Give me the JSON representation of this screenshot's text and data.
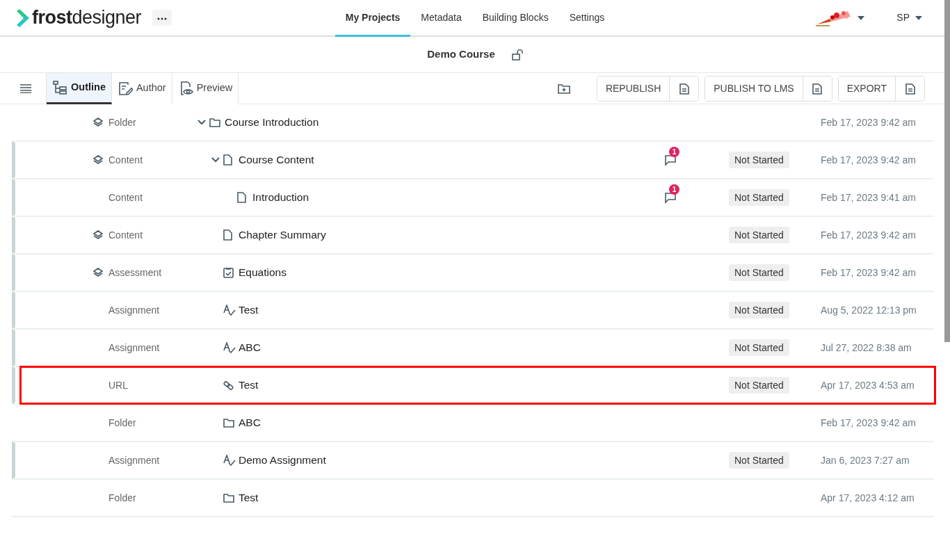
{
  "app": {
    "logo_bold": "frost",
    "logo_light": "designer"
  },
  "nav_tabs": [
    {
      "label": "My Projects",
      "selected": true
    },
    {
      "label": "Metadata",
      "selected": false
    },
    {
      "label": "Building Blocks",
      "selected": false
    },
    {
      "label": "Settings",
      "selected": false
    }
  ],
  "user": {
    "initials": "SP"
  },
  "course": {
    "title": "Demo Course",
    "locked": false
  },
  "view_tabs": [
    {
      "label": "Outline",
      "kind": "outline",
      "selected": true
    },
    {
      "label": "Author",
      "kind": "author",
      "selected": false
    },
    {
      "label": "Preview",
      "kind": "preview",
      "selected": false
    }
  ],
  "actions": [
    {
      "label": "REPUBLISH"
    },
    {
      "label": "PUBLISH TO LMS"
    },
    {
      "label": "EXPORT"
    }
  ],
  "outline": [
    {
      "type": "Folder",
      "kind": "folder",
      "name": "Course Introduction",
      "layers": true,
      "expanded": true,
      "date": "Feb 17, 2023 9:42 am",
      "children": [
        {
          "type": "Content",
          "kind": "content",
          "name": "Course Content",
          "layers": true,
          "expanded": true,
          "comments": "1",
          "status": "Not Started",
          "date": "Feb 17, 2023 9:42 am",
          "children": [
            {
              "type": "Content",
              "kind": "content",
              "name": "Introduction",
              "layers": false,
              "comments": "1",
              "status": "Not Started",
              "date": "Feb 17, 2023 9:41 am"
            }
          ]
        },
        {
          "type": "Content",
          "kind": "content",
          "name": "Chapter Summary",
          "layers": true,
          "status": "Not Started",
          "date": "Feb 17, 2023 9:42 am"
        },
        {
          "type": "Assessment",
          "kind": "assessment",
          "name": "Equations",
          "layers": true,
          "status": "Not Started",
          "date": "Feb 17, 2023 9:42 am"
        },
        {
          "type": "Assignment",
          "kind": "assignment",
          "name": "Test",
          "layers": false,
          "status": "Not Started",
          "date": "Aug 5, 2022 12:13 pm"
        },
        {
          "type": "Assignment",
          "kind": "assignment",
          "name": "ABC",
          "layers": false,
          "status": "Not Started",
          "date": "Jul 27, 2022 8:38 am"
        },
        {
          "type": "URL",
          "kind": "url",
          "name": "Test",
          "layers": false,
          "status": "Not Started",
          "date": "Apr 17, 2023 4:53 am",
          "highlighted": true
        },
        {
          "type": "Folder",
          "kind": "folder",
          "name": "ABC",
          "layers": false,
          "date": "Feb 17, 2023 9:42 am"
        },
        {
          "type": "Assignment",
          "kind": "assignment",
          "name": "Demo Assignment",
          "layers": false,
          "status": "Not Started",
          "date": "Jan 6, 2023 7:27 am"
        },
        {
          "type": "Folder",
          "kind": "folder",
          "name": "Test",
          "layers": false,
          "date": "Apr 17, 2023 4:12 am"
        }
      ]
    }
  ]
}
